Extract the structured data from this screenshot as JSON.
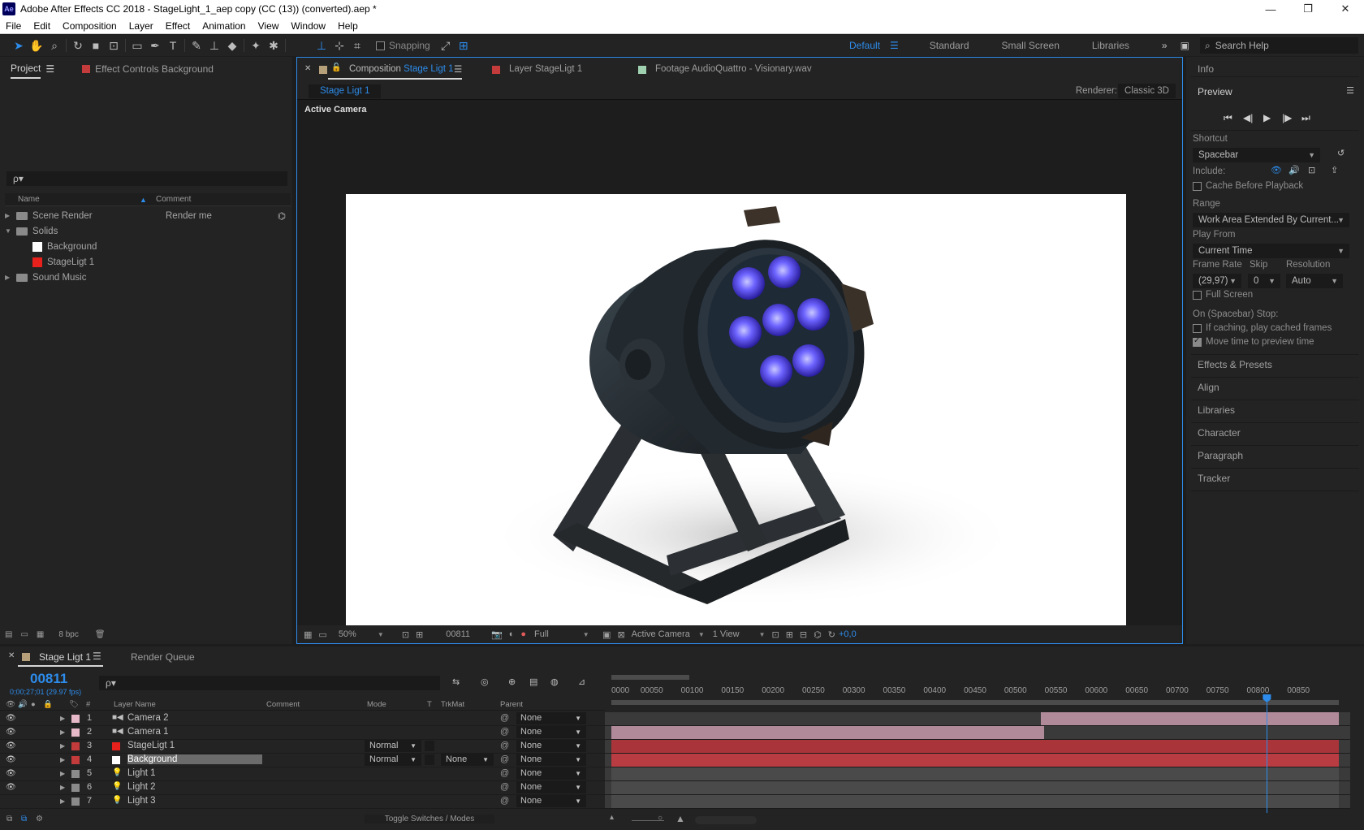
{
  "window": {
    "logo": "Ae",
    "title": "Adobe After Effects CC 2018 - StageLight_1_aep copy (CC (13)) (converted).aep *",
    "controls": [
      "—",
      "❐",
      "✕"
    ]
  },
  "menu": [
    "File",
    "Edit",
    "Composition",
    "Layer",
    "Effect",
    "Animation",
    "View",
    "Window",
    "Help"
  ],
  "toolbar": {
    "snapping_label": "Snapping",
    "workspaces": [
      "Default",
      "Standard",
      "Small Screen",
      "Libraries"
    ],
    "active_workspace": "Default",
    "search_placeholder": "Search Help"
  },
  "project": {
    "tab_label": "Project",
    "effect_controls_label": "Effect Controls Background",
    "search_icon": "ρ▾",
    "columns": {
      "name": "Name",
      "comment": "Comment"
    },
    "items": [
      {
        "name": "Scene Render",
        "kind": "folder",
        "expanded": false,
        "comment": "Render me",
        "indent": 0
      },
      {
        "name": "Solids",
        "kind": "folder",
        "expanded": true,
        "comment": "",
        "indent": 0
      },
      {
        "name": "Background",
        "kind": "solid",
        "color": "#ffffff",
        "comment": "",
        "indent": 1
      },
      {
        "name": "StageLigt 1",
        "kind": "solid",
        "color": "#e8211d",
        "comment": "",
        "indent": 1
      },
      {
        "name": "Sound Music",
        "kind": "folder",
        "expanded": false,
        "comment": "",
        "indent": 0
      }
    ],
    "bpc": "8 bpc"
  },
  "composition": {
    "tabs": [
      {
        "prefix": "Composition",
        "name": "Stage Ligt 1",
        "color": "#b6a07a",
        "active": true
      },
      {
        "prefix": "Layer",
        "name": "StageLigt 1",
        "color": "#e8211d",
        "active": false
      },
      {
        "prefix": "Footage",
        "name": "AudioQuattro - Visionary.wav",
        "color": "#9fd0b0",
        "active": false
      }
    ],
    "breadcrumb": "Stage Ligt 1",
    "renderer_label": "Renderer:",
    "renderer_value": "Classic 3D",
    "viewer_label": "Active Camera",
    "footer": {
      "zoom": "50%",
      "frame": "00811",
      "resolution": "Full",
      "view": "Active Camera",
      "layout": "1 View",
      "exposure": "+0,0"
    }
  },
  "right_panel": {
    "info_label": "Info",
    "preview_label": "Preview",
    "shortcut_label": "Shortcut",
    "shortcut_value": "Spacebar",
    "include_label": "Include:",
    "cache_before_playback": {
      "label": "Cache Before Playback",
      "checked": false
    },
    "range_label": "Range",
    "range_value": "Work Area Extended By Current...",
    "play_from_label": "Play From",
    "play_from_value": "Current Time",
    "frame_rate_label": "Frame Rate",
    "frame_rate_value": "(29,97)",
    "skip_label": "Skip",
    "skip_value": "0",
    "resolution_label": "Resolution",
    "resolution_value": "Auto",
    "full_screen": {
      "label": "Full Screen",
      "checked": false
    },
    "stop_label": "On (Spacebar) Stop:",
    "if_caching": {
      "label": "If caching, play cached frames",
      "checked": false
    },
    "move_time": {
      "label": "Move time to preview time",
      "checked": true
    },
    "collapsed_panels": [
      "Effects & Presets",
      "Align",
      "Libraries",
      "Character",
      "Paragraph",
      "Tracker"
    ]
  },
  "timeline": {
    "comp_tab": "Stage Ligt 1",
    "render_queue_tab": "Render Queue",
    "timecode": "00811",
    "timecode_sub": "0;00;27;01 (29.97 fps)",
    "search_icon": "ρ▾",
    "columns": {
      "hash": "#",
      "layer_name": "Layer Name",
      "comment": "Comment",
      "mode": "Mode",
      "t": "T",
      "trkmat": "TrkMat",
      "parent": "Parent"
    },
    "layers": [
      {
        "num": "1",
        "name": "Camera 2",
        "type": "camera",
        "label_color": "#e6b8c8",
        "mode": "",
        "trkmat": "",
        "parent": "None",
        "visible": true,
        "bar_start": 0.59,
        "bar_end": 1.0,
        "bar_color": "#b08a98",
        "selected": false
      },
      {
        "num": "2",
        "name": "Camera 1",
        "type": "camera",
        "label_color": "#e6b8c8",
        "mode": "",
        "trkmat": "",
        "parent": "None",
        "visible": true,
        "bar_start": 0.0,
        "bar_end": 0.595,
        "bar_color": "#b08a98",
        "selected": false
      },
      {
        "num": "3",
        "name": "StageLigt 1",
        "type": "solid",
        "label_color": "#c43b3b",
        "mode": "Normal",
        "trkmat": "",
        "parent": "None",
        "visible": true,
        "bar_start": 0.0,
        "bar_end": 1.0,
        "bar_color": "#a9353a",
        "selected": false
      },
      {
        "num": "4",
        "name": "Background",
        "type": "solid",
        "label_color": "#c43b3b",
        "mode": "Normal",
        "trkmat": "None",
        "parent": "None",
        "visible": true,
        "bar_start": 0.0,
        "bar_end": 1.0,
        "bar_color": "#b83c42",
        "selected": true
      },
      {
        "num": "5",
        "name": "Light 1",
        "type": "light",
        "label_color": "#8a8a8a",
        "mode": "",
        "trkmat": "",
        "parent": "None",
        "visible": true,
        "bar_start": 0.0,
        "bar_end": 1.0,
        "bar_color": "#4a4a4a",
        "selected": false
      },
      {
        "num": "6",
        "name": "Light 2",
        "type": "light",
        "label_color": "#8a8a8a",
        "mode": "",
        "trkmat": "",
        "parent": "None",
        "visible": true,
        "bar_start": 0.0,
        "bar_end": 1.0,
        "bar_color": "#4a4a4a",
        "selected": false
      },
      {
        "num": "7",
        "name": "Light 3",
        "type": "light",
        "label_color": "#8a8a8a",
        "mode": "",
        "trkmat": "",
        "parent": "None",
        "visible": false,
        "bar_start": 0.0,
        "bar_end": 1.0,
        "bar_color": "#4a4a4a",
        "selected": false
      }
    ],
    "ruler_ticks": [
      "0000",
      "00050",
      "00100",
      "00150",
      "00200",
      "00250",
      "00300",
      "00350",
      "00400",
      "00450",
      "00500",
      "00550",
      "00600",
      "00650",
      "00700",
      "00750",
      "00800",
      "00850"
    ],
    "ruler_start": 0,
    "ruler_end": 900,
    "current_frame": 811,
    "footer_label": "Toggle Switches / Modes"
  },
  "colors": {
    "accent": "#2d8ceb",
    "panel": "#232323",
    "background": "#1d1d1d"
  }
}
